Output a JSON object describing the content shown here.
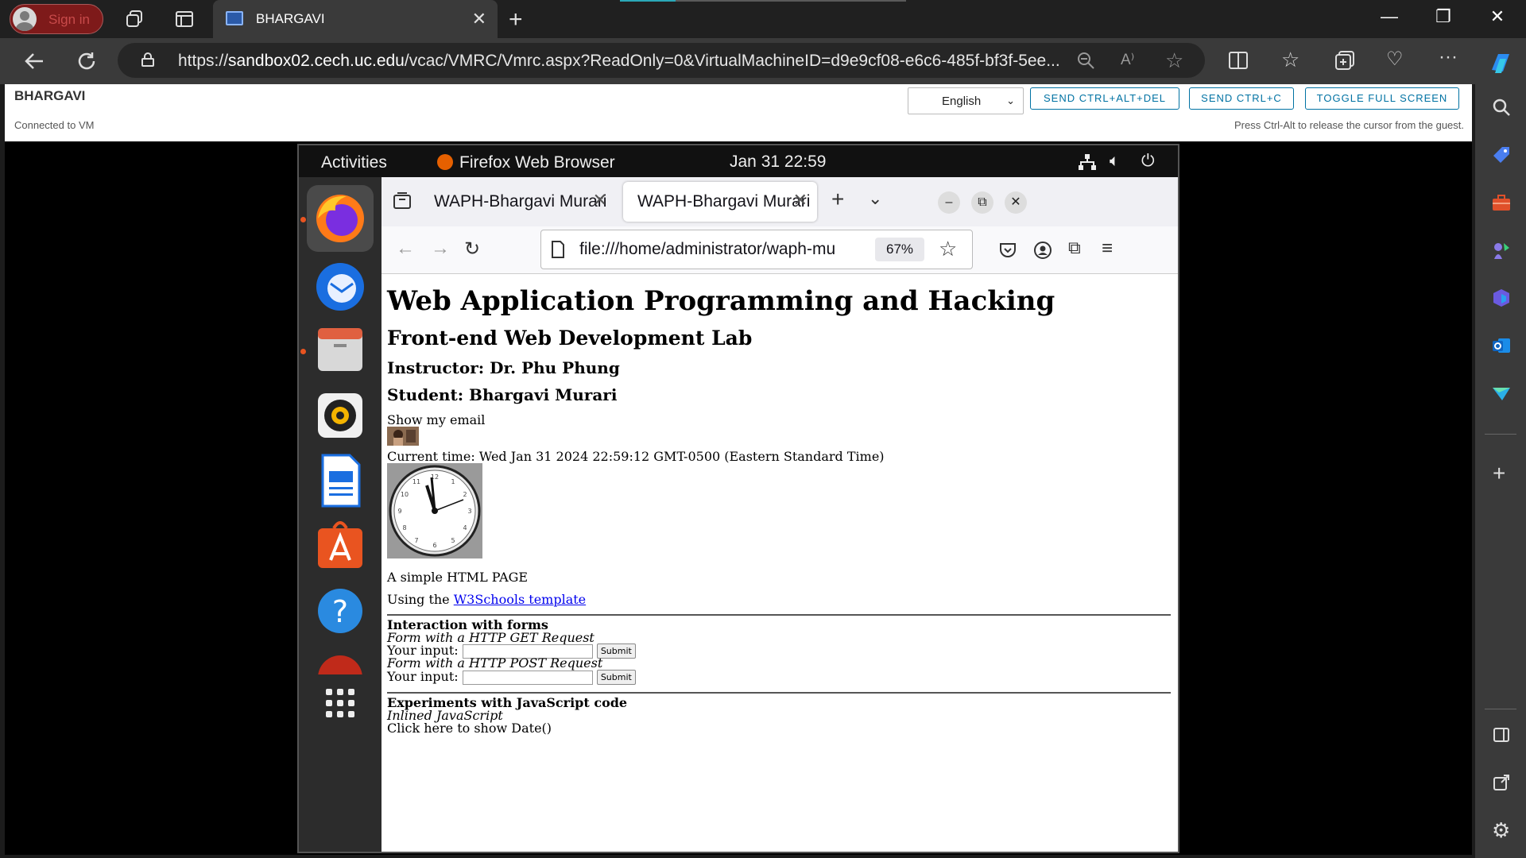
{
  "edge": {
    "signin_label": "Sign in",
    "tab_title": "BHARGAVI",
    "tab_close": "✕",
    "new_tab": "+",
    "url_prefix": "https://",
    "url_host": "sandbox02.cech.uc.edu",
    "url_rest": "/vcac/VMRC/Vmrc.aspx?ReadOnly=0&VirtualMachineID=d9e9cf08-e6c6-485f-bf3f-5ee..."
  },
  "vmrc": {
    "vm_name": "BHARGAVI",
    "status": "Connected to VM",
    "language": "English",
    "btn_ctrl_alt_del": "SEND CTRL+ALT+DEL",
    "btn_ctrl_c": "SEND CTRL+C",
    "btn_fullscreen": "TOGGLE FULL SCREEN",
    "hint": "Press Ctrl-Alt to release the cursor from the guest."
  },
  "ubuntu": {
    "activities": "Activities",
    "app_name": "Firefox Web Browser",
    "clock": "Jan 31  22:59"
  },
  "firefox": {
    "tabs": [
      {
        "title": "WAPH-Bhargavi Murari"
      },
      {
        "title": "WAPH-Bhargavi Murari"
      }
    ],
    "url": "file:///home/administrator/waph-mu",
    "zoom": "67%"
  },
  "page": {
    "h1": "Web Application Programming and Hacking",
    "h2": "Front-end Web Development Lab",
    "instructor": "Instructor: Dr. Phu Phung",
    "student": "Student: Bhargavi Murari",
    "show_email": "Show my email",
    "current_time": "Current time: Wed Jan 31 2024 22:59:12 GMT-0500 (Eastern Standard Time)",
    "simple": "A simple HTML PAGE",
    "using_prefix": "Using the ",
    "using_link": "W3Schools template",
    "forms_heading": "Interaction with forms",
    "get_label": "Form with a HTTP GET Request",
    "post_label": "Form with a HTTP POST Request",
    "your_input": "Your input:",
    "submit": "Submit",
    "js_heading": "Experiments with JavaScript code",
    "inlined": "Inlined JavaScript",
    "click_date": "Click here to show Date()"
  },
  "colors": {
    "vmrc_accent": "#0072a3",
    "ubuntu_orange": "#e95420"
  }
}
